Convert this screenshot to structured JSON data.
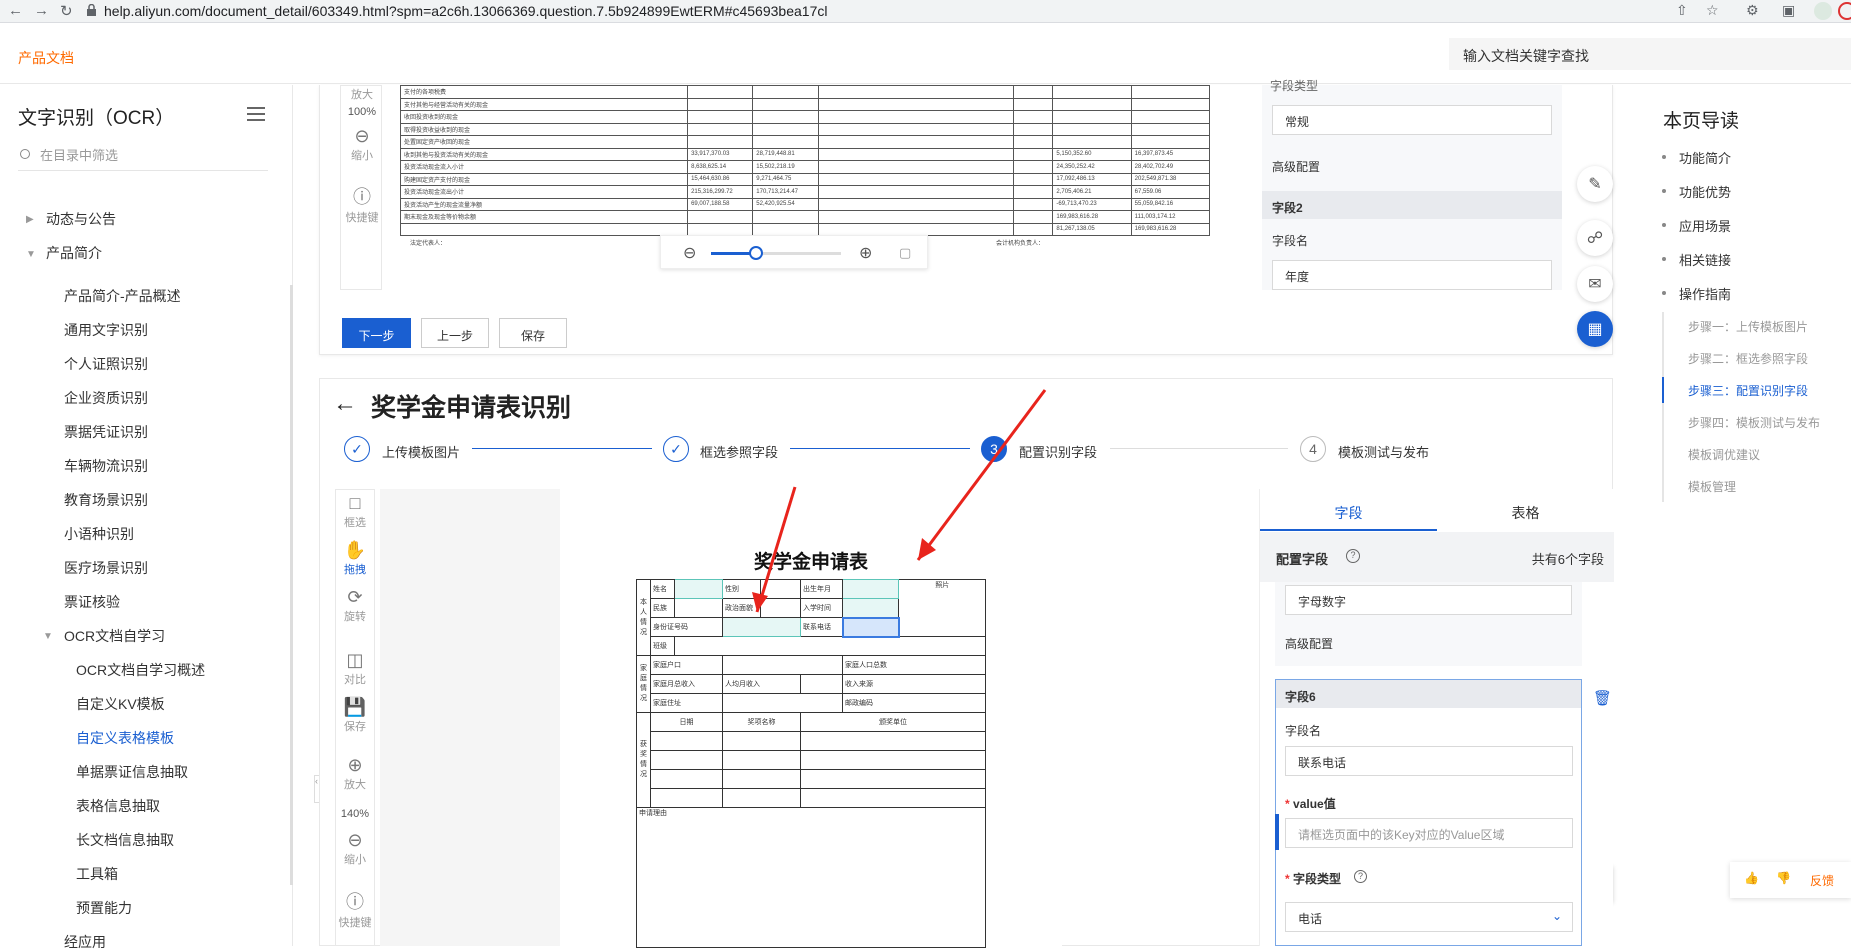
{
  "browser": {
    "url": "help.aliyun.com/document_detail/603349.html?spm=a2c6h.13066369.question.7.5b924899EwtERM#c45693bea17cl"
  },
  "header": {
    "brand": "产品文档",
    "search_placeholder": "输入文档关键字查找"
  },
  "sidebar": {
    "title": "文字识别（OCR）",
    "filter_placeholder": "在目录中筛选",
    "items": [
      {
        "label": "动态与公告"
      },
      {
        "label": "产品简介"
      },
      {
        "label": "产品简介-产品概述"
      },
      {
        "label": "通用文字识别"
      },
      {
        "label": "个人证照识别"
      },
      {
        "label": "企业资质识别"
      },
      {
        "label": "票据凭证识别"
      },
      {
        "label": "车辆物流识别"
      },
      {
        "label": "教育场景识别"
      },
      {
        "label": "小语种识别"
      },
      {
        "label": "医疗场景识别"
      },
      {
        "label": "票证核验"
      },
      {
        "label": "OCR文档自学习"
      },
      {
        "label": "OCR文档自学习概述"
      },
      {
        "label": "自定义KV模板"
      },
      {
        "label": "自定义表格模板"
      },
      {
        "label": "单据票证信息抽取"
      },
      {
        "label": "表格信息抽取"
      },
      {
        "label": "长文档信息抽取"
      },
      {
        "label": "工具箱"
      },
      {
        "label": "预置能力"
      },
      {
        "label": "经应用"
      }
    ]
  },
  "top_card": {
    "tools": {
      "zoom_in": "放大",
      "zoom_level": "100%",
      "zoom_out": "缩小",
      "shortcuts": "快捷键"
    },
    "right": {
      "partial_label": "字段类型",
      "type_value": "常规",
      "advanced": "高级配置",
      "field2_title": "字段2",
      "field_name_label": "字段名",
      "field_name_value": "年度"
    },
    "buttons": {
      "next": "下一步",
      "prev": "上一步",
      "save": "保存"
    },
    "doc_rows": [
      [
        "支付的各项税费",
        "",
        "",
        "",
        "",
        "",
        ""
      ],
      [
        "支付其他与经营活动有关的现金",
        "",
        "",
        "",
        "",
        "",
        ""
      ],
      [
        "收回投资收到的现金",
        "",
        "",
        "",
        "",
        "",
        ""
      ],
      [
        "取得投资收益收到的现金",
        "",
        "",
        "",
        "",
        "",
        ""
      ],
      [
        "处置固定资产收回的现金",
        "",
        "",
        "",
        "",
        "",
        ""
      ],
      [
        "收到其他与投资活动有关的现金",
        "33,917,370.03",
        "28,719,448.81",
        "",
        "",
        "5,150,352.60",
        "16,397,873.45"
      ],
      [
        "投资活动现金流入小计",
        "8,638,625.14",
        "15,502,218.19",
        "",
        "",
        "24,350,252.42",
        "28,402,702.49"
      ],
      [
        "购建固定资产支付的现金",
        "15,464,630.86",
        "9,271,464.75",
        "",
        "",
        "17,092,486.13",
        "202,549,871.38"
      ],
      [
        "投资活动现金流出小计",
        "215,316,299.72",
        "170,713,214.47",
        "",
        "",
        "2,705,406.21",
        "67,559.06"
      ],
      [
        "投资活动产生的现金流量净额",
        "69,007,188.58",
        "52,420,925.54",
        "",
        "",
        "-69,713,470.23",
        "55,059,842.16"
      ],
      [
        "期末现金及现金等价物余额",
        "",
        "",
        "",
        "",
        "169,983,616.28",
        "111,003,174.12"
      ],
      [
        "",
        "",
        "",
        "",
        "",
        "81,267,138.05",
        "169,983,616.28"
      ]
    ],
    "doc_footer_left": "法定代表人：",
    "doc_footer_right": "会计机构负责人："
  },
  "main": {
    "title": "奖学金申请表识别",
    "steps": [
      {
        "num": "1",
        "label": "上传模板图片"
      },
      {
        "num": "2",
        "label": "框选参照字段"
      },
      {
        "num": "3",
        "label": "配置识别字段"
      },
      {
        "num": "4",
        "label": "模板测试与发布"
      }
    ],
    "tools": {
      "select": "框选",
      "drag": "拖拽",
      "rotate": "旋转",
      "compare": "对比",
      "save": "保存",
      "zoom_in": "放大",
      "zoom_level": "140%",
      "zoom_out": "缩小",
      "shortcuts": "快捷键"
    },
    "form": {
      "title": "奖学金申请表",
      "c_personal": "本人情况",
      "name": "姓名",
      "gender": "性别",
      "birth": "出生年月",
      "photo": "照片",
      "ethnic": "民族",
      "politics": "政治面貌",
      "enroll": "入学时间",
      "idno": "身份证号码",
      "phone": "联系电话",
      "class": "班级",
      "c_family": "家庭情况",
      "household": "家庭户口",
      "members": "家庭人口总数",
      "income": "家庭月总收入",
      "percap": "人均月收入",
      "source": "收入来源",
      "address": "家庭住址",
      "postcode": "邮政编码",
      "c_award": "获奖情况",
      "date": "日期",
      "award_name": "奖项名称",
      "org": "颁奖单位",
      "reason": "申请理由"
    },
    "panel": {
      "tab_field": "字段",
      "tab_table": "表格",
      "config_label": "配置字段",
      "count": "共有6个字段",
      "prev_type": "字母数字",
      "advanced": "高级配置",
      "field6_title": "字段6",
      "field_name_label": "字段名",
      "field_name_value": "联系电话",
      "value_label": "value值",
      "value_placeholder": "请框选页面中的该Key对应的Value区域",
      "type_label": "字段类型",
      "type_value": "电话"
    }
  },
  "toc": {
    "title": "本页导读",
    "items": [
      "功能简介",
      "功能优势",
      "应用场景",
      "相关链接",
      "操作指南"
    ],
    "subs": [
      "步骤一：上传模板图片",
      "步骤二：框选参照字段",
      "步骤三：配置识别字段",
      "步骤四：模板测试与发布",
      "模板调优建议",
      "模板管理"
    ]
  },
  "feedback": {
    "label": "反馈"
  },
  "colors": {
    "accent": "#1a5fd1",
    "brand": "#ff6a00",
    "annotation_arrow": "#e8241c"
  }
}
